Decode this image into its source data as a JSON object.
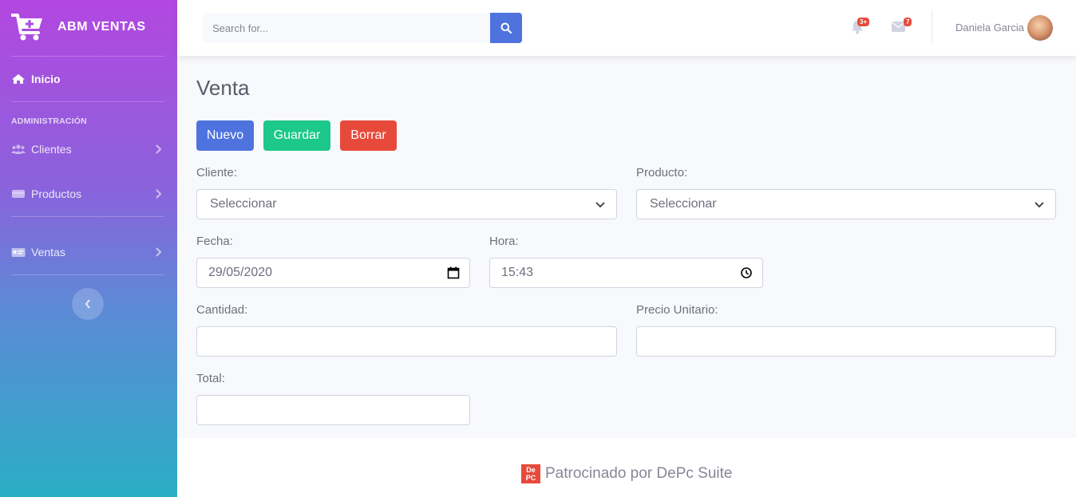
{
  "sidebar": {
    "brand": "ABM VENTAS",
    "home": "Inicio",
    "section_heading": "ADMINISTRACIÓN",
    "items": [
      {
        "label": "Clientes",
        "icon": "users-icon"
      },
      {
        "label": "Productos",
        "icon": "box-icon"
      },
      {
        "label": "Ventas",
        "icon": "id-card-icon"
      }
    ]
  },
  "topbar": {
    "search_placeholder": "Search for...",
    "alerts_count": "3+",
    "messages_count": "7",
    "user_name": "Daniela Garcia"
  },
  "main": {
    "title": "Venta",
    "buttons": {
      "new": "Nuevo",
      "save": "Guardar",
      "delete": "Borrar"
    },
    "form": {
      "client_label": "Cliente:",
      "client_value": "Seleccionar",
      "product_label": "Producto:",
      "product_value": "Seleccionar",
      "date_label": "Fecha:",
      "date_value": "29/05/2020",
      "time_label": "Hora:",
      "time_value": "15:43",
      "quantity_label": "Cantidad:",
      "quantity_value": "",
      "unit_price_label": "Precio Unitario:",
      "unit_price_value": "",
      "total_label": "Total:",
      "total_value": ""
    }
  },
  "footer": {
    "logo_text": "DePC",
    "text": "Patrocinado por DePc Suite"
  },
  "colors": {
    "primary": "#4e73df",
    "success": "#1cc88a",
    "danger": "#e74a3b",
    "sidebar_top": "#b347e0",
    "sidebar_bottom": "#2aaec4"
  }
}
